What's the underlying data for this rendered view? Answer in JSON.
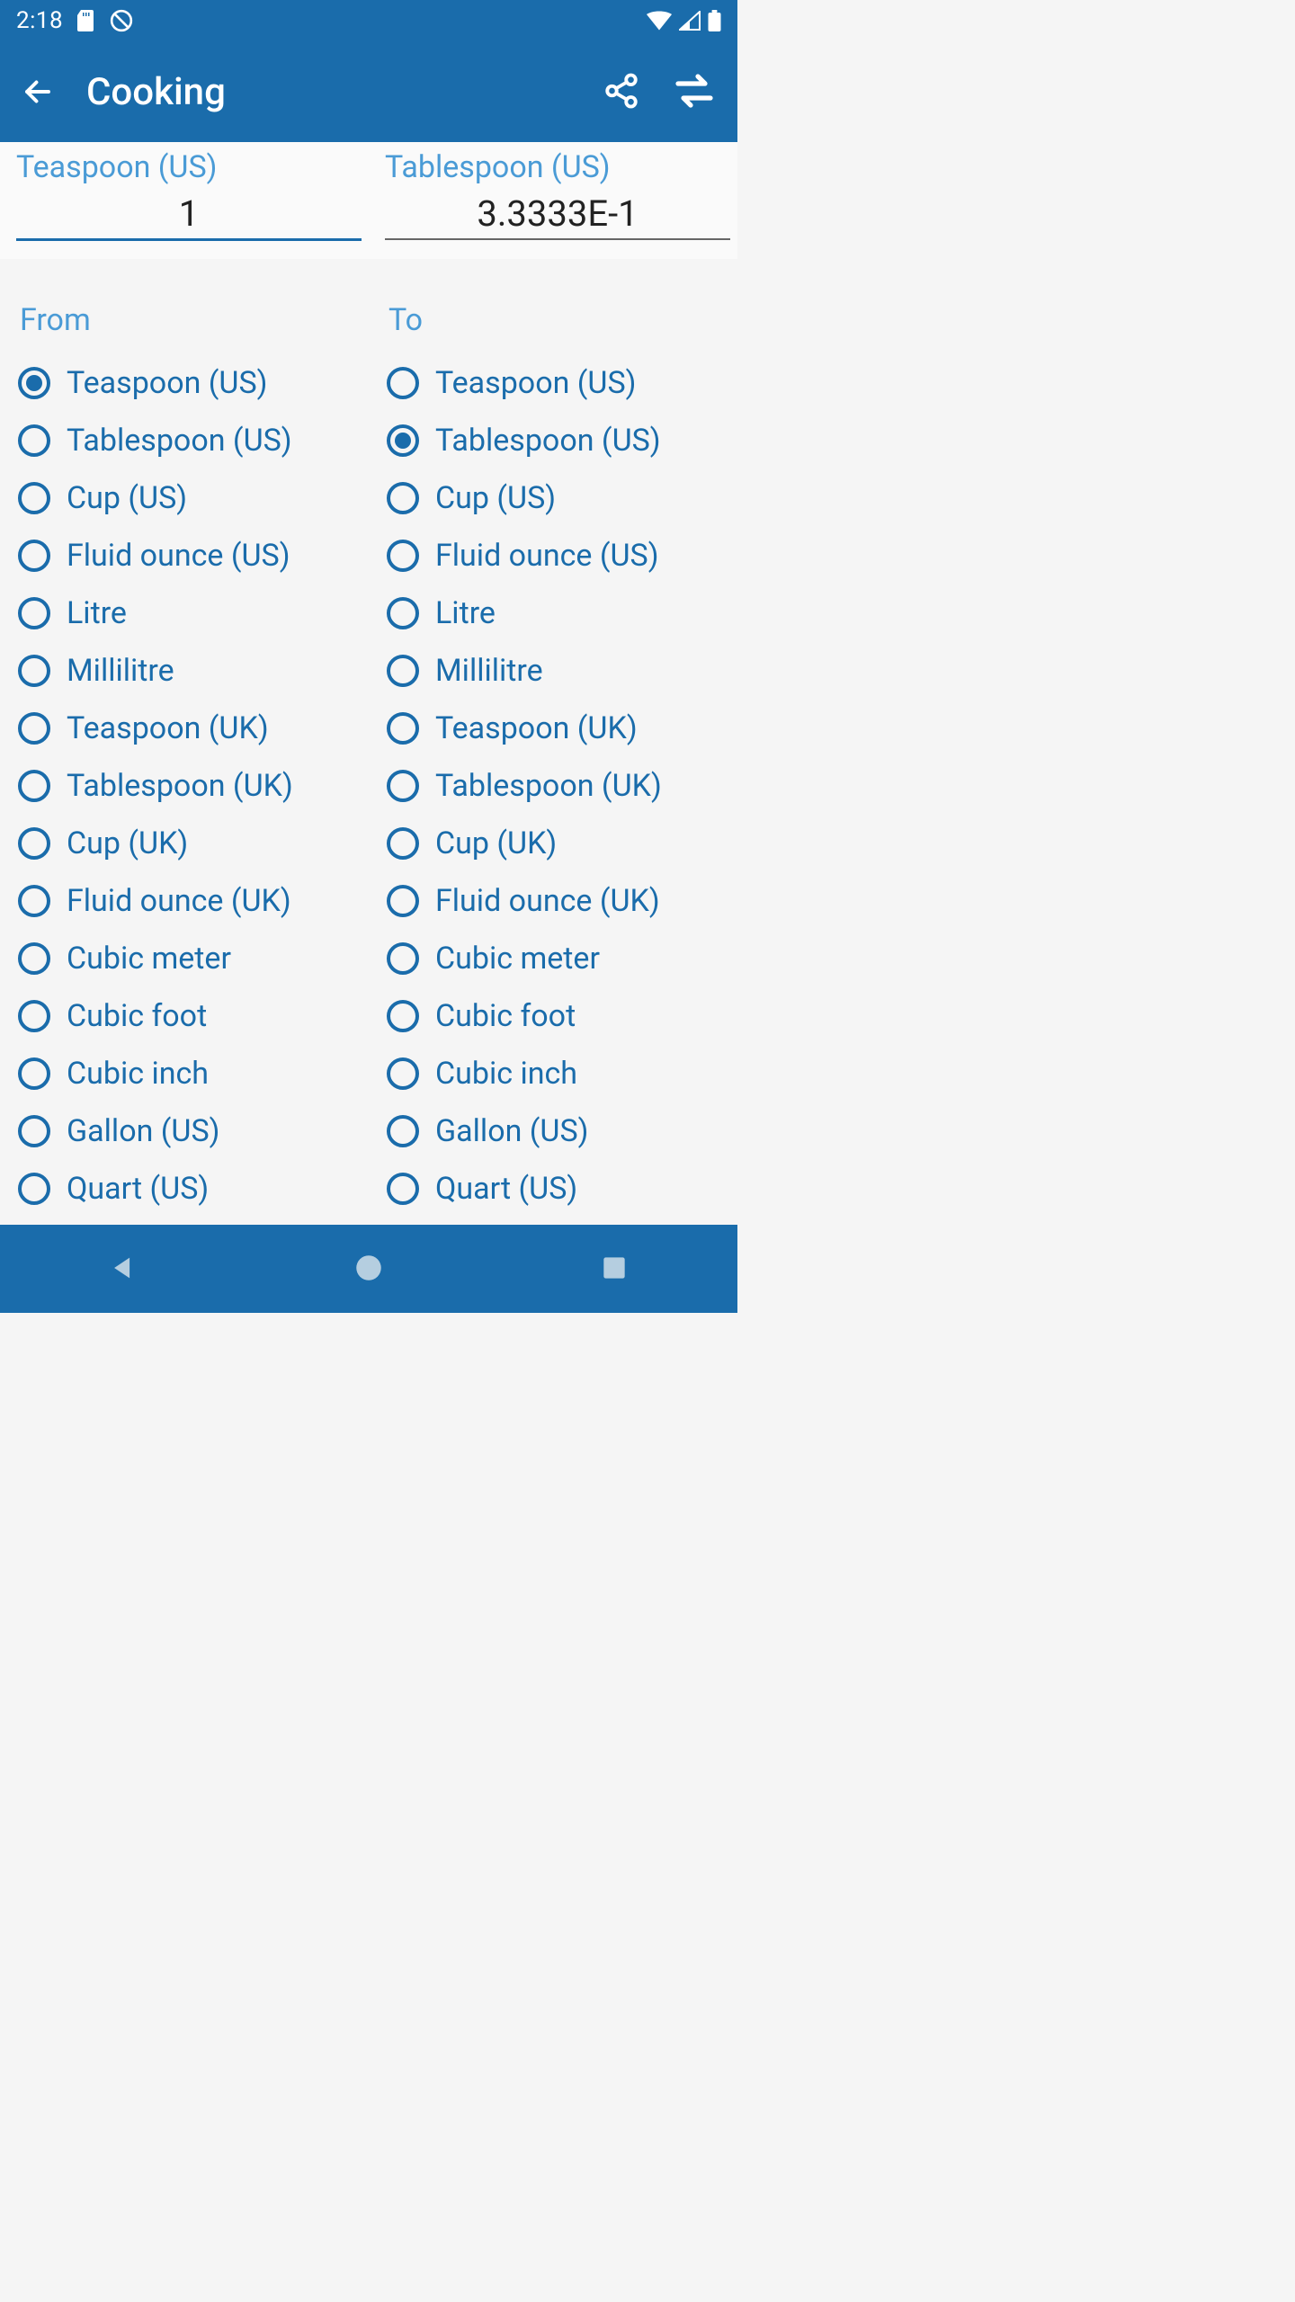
{
  "statusbar": {
    "time": "2:18"
  },
  "appbar": {
    "title": "Cooking"
  },
  "conversion": {
    "from_label": "Teaspoon (US)",
    "to_label": "Tablespoon (US)",
    "from_value": "1",
    "to_value": "3.3333E-1"
  },
  "columns": {
    "from_header": "From",
    "to_header": "To"
  },
  "from_selected_index": 0,
  "to_selected_index": 1,
  "units": [
    "Teaspoon (US)",
    "Tablespoon (US)",
    "Cup (US)",
    "Fluid ounce (US)",
    "Litre",
    "Millilitre",
    "Teaspoon (UK)",
    "Tablespoon (UK)",
    "Cup (UK)",
    "Fluid ounce (UK)",
    "Cubic meter",
    "Cubic foot",
    "Cubic inch",
    "Gallon (US)",
    "Quart (US)"
  ]
}
